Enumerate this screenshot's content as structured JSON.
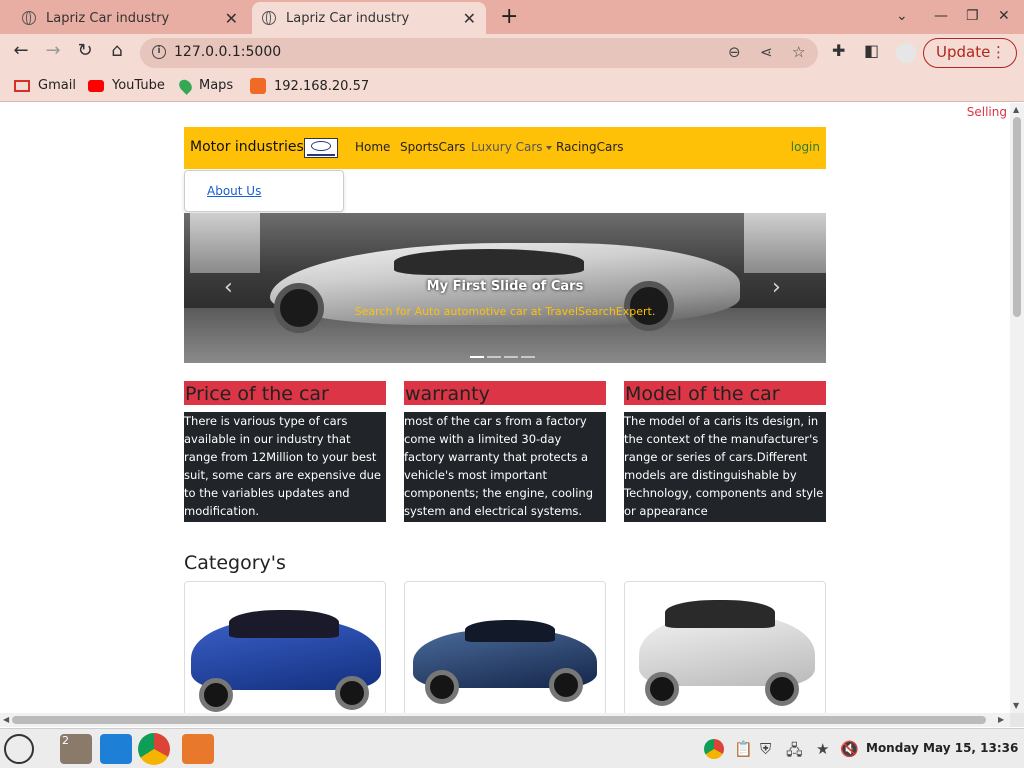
{
  "browser": {
    "tabs": [
      {
        "title": "Lapriz Car industry"
      },
      {
        "title": "Lapriz Car industry"
      }
    ],
    "url": "127.0.0.1:5000",
    "update_label": "Update",
    "bookmarks": [
      {
        "label": "Gmail"
      },
      {
        "label": "YouTube"
      },
      {
        "label": "Maps"
      },
      {
        "label": "192.168.20.57"
      }
    ]
  },
  "page": {
    "selling": "Selling",
    "navbar": {
      "brand": "Motor industries",
      "links": [
        "Home",
        "SportsCars",
        "Luxury Cars",
        "RacingCars"
      ],
      "login": "login"
    },
    "dropdown": {
      "item": "About Us"
    },
    "carousel": {
      "title": "My First Slide of Cars",
      "subtitle": "Search for Auto automotive car at TravelSearchExpert.",
      "slides": 4,
      "active": 0
    },
    "info": [
      {
        "heading": "Price of the car",
        "text": "There is various type of cars available in our industry that range from 12Million to your best suit, some cars are expensive due to the variables updates and modification."
      },
      {
        "heading": "warranty",
        "text": "most of the car s from a factory come with a limited 30-day factory warranty that protects a vehicle's most important components; the engine, cooling system and electrical systems."
      },
      {
        "heading": "Model of the car",
        "text": "The model of a caris its design, in the context of the manufacturer's range or series of cars.Different models are distinguishable by Technology, components and style or appearance"
      }
    ],
    "category_title": "Category's"
  },
  "taskbar": {
    "clock": "Monday May 15, 13:36",
    "workspace_badge": "2"
  },
  "colors": {
    "navbar": "#ffc107",
    "heading_red": "#dc3545",
    "text_dark_bg": "#212529",
    "tabbar": "#e8aea3",
    "toolbar": "#f4dcd5"
  }
}
